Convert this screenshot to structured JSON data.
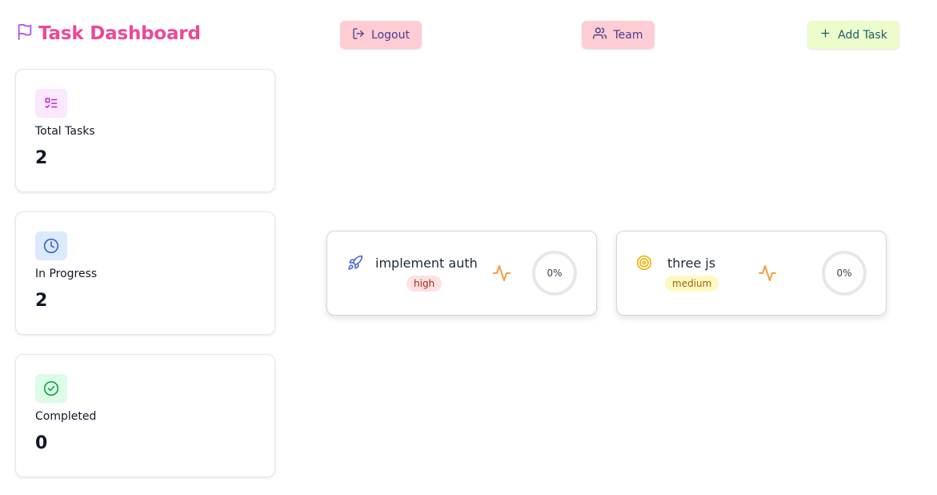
{
  "header": {
    "title": "Task Dashboard",
    "title_color": "#ec4899",
    "icon": "flag-icon",
    "buttons": {
      "logout": "Logout",
      "team": "Team",
      "add_task": "Add Task"
    }
  },
  "stats": [
    {
      "label": "Total Tasks",
      "value": "2",
      "icon": "list-checks-icon",
      "icon_bg": "#fae8ff",
      "icon_color": "#c026d3"
    },
    {
      "label": "In Progress",
      "value": "2",
      "icon": "clock-icon",
      "icon_bg": "#dbeafe",
      "icon_color": "#3b63d6"
    },
    {
      "label": "Completed",
      "value": "0",
      "icon": "check-circle-icon",
      "icon_bg": "#dcfce7",
      "icon_color": "#16a34a"
    }
  ],
  "tasks": [
    {
      "title": "implement auth",
      "priority": "high",
      "progress_label": "0%",
      "progress": 0,
      "icon": "rocket-icon"
    },
    {
      "title": "three js",
      "priority": "medium",
      "progress_label": "0%",
      "progress": 0,
      "icon": "target-icon"
    }
  ],
  "colors": {
    "button_pink": "#fecdd3",
    "button_lime": "#ecfccb",
    "activity_orange": "#f59e42"
  }
}
